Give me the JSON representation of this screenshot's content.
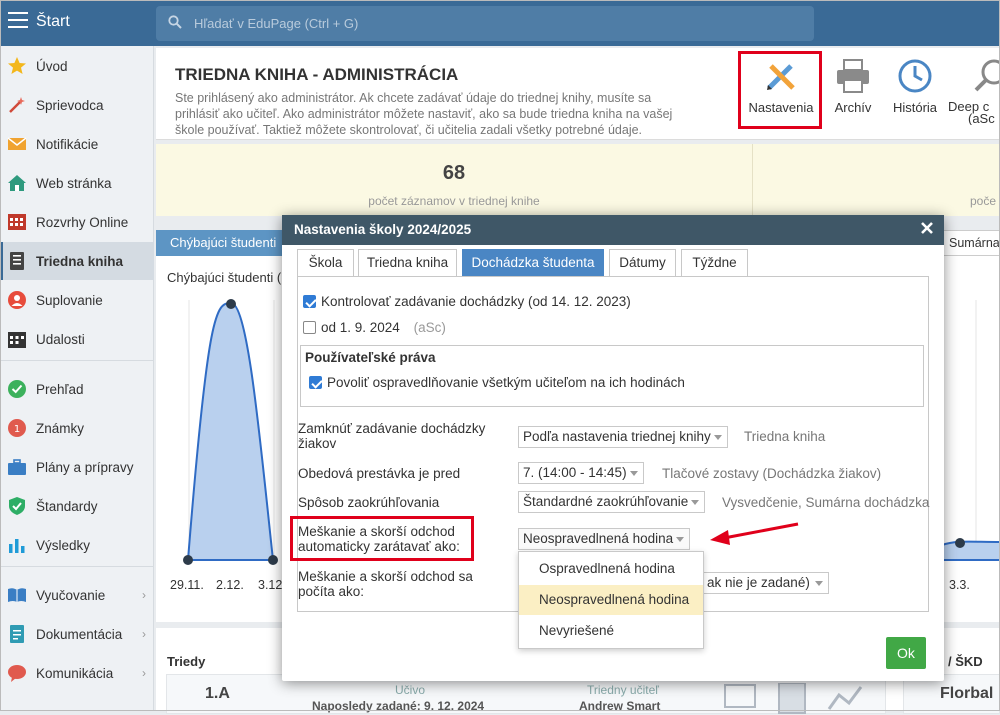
{
  "topbar": {
    "title": "Štart",
    "search_placeholder": "Hľadať v EduPage (Ctrl + G)"
  },
  "sidebar": {
    "items": [
      {
        "label": "Úvod"
      },
      {
        "label": "Sprievodca"
      },
      {
        "label": "Notifikácie"
      },
      {
        "label": "Web stránka"
      },
      {
        "label": "Rozvrhy Online"
      },
      {
        "label": "Triedna kniha"
      },
      {
        "label": "Suplovanie"
      },
      {
        "label": "Udalosti"
      },
      {
        "label": "Prehľad"
      },
      {
        "label": "Známky"
      },
      {
        "label": "Plány a prípravy"
      },
      {
        "label": "Štandardy"
      },
      {
        "label": "Výsledky"
      },
      {
        "label": "Vyučovanie"
      },
      {
        "label": "Dokumentácia"
      },
      {
        "label": "Komunikácia"
      }
    ],
    "active": "Triedna kniha"
  },
  "header": {
    "title": "TRIEDNA KNIHA - ADMINISTRÁCIA",
    "description": "Ste prihlásený ako administrátor. Ak chcete zadávať údaje do triednej knihy, musíte sa prihlásiť ako učiteľ. Ako administrátor môžete nastaviť, ako sa bude triedna kniha na vašej škole používať. Taktiež môžete skontrolovať, či učitelia zadali všetky potrebné údaje.",
    "tools": {
      "settings": "Nastavenia",
      "archive": "Archív",
      "history": "História",
      "deep": "Deep c",
      "deep_sub": "(aSc"
    }
  },
  "stats": {
    "count": "68",
    "count_label": "počet záznamov v triednej knihe",
    "label2": "poče"
  },
  "chart_panel": {
    "tab": "Chýbajúci študenti",
    "tab_right": "Sumárna d",
    "caption": "Chýbajúci študenti (",
    "x_left": [
      "29.11.",
      "2.12.",
      "3.12"
    ],
    "x_right": "3.3."
  },
  "bottom": {
    "classes_title": "Triedy",
    "class_name": "1.A",
    "ucivo_label": "Učivo",
    "last_entered": "Naposledy zadané: 9. 12. 2024",
    "teacher_label": "Triedny učiteľ",
    "teacher": "Andrew Smart",
    "right_title": "/ ŠKD",
    "right_card": "Florbal"
  },
  "modal": {
    "title": "Nastavenia školy 2024/2025",
    "tabs": [
      "Škola",
      "Triedna kniha",
      "Dochádzka študenta",
      "Dátumy",
      "Týždne"
    ],
    "active_tab": "Dochádzka študenta",
    "check_control": {
      "label": "Kontrolovať zadávanie dochádzky (od 14. 12. 2023)",
      "checked": true
    },
    "check_from": {
      "label": "od 1. 9. 2024",
      "extra": "(aSc)",
      "checked": false
    },
    "user_rights": {
      "legend": "Používateľské práva",
      "check_excuse": {
        "label": "Povoliť ospravedlňovanie všetkým učiteľom na ich hodinách",
        "checked": true
      }
    },
    "fields": [
      {
        "label": "Zamknúť zadávanie dochádzky žiakov",
        "value": "Podľa nastavenia triednej knihy",
        "hint": "Triedna kniha"
      },
      {
        "label": "Obedová prestávka je pred",
        "value": "7. (14:00 - 14:45)",
        "hint": "Tlačové zostavy (Dochádzka žiakov)"
      },
      {
        "label": "Spôsob zaokrúhľovania",
        "value": "Štandardné zaokrúhľovanie",
        "hint": "Vysvedčenie, Sumárna dochádzka"
      },
      {
        "label": "Meškanie a skorší odchod automaticky zarátavať ako:",
        "value": "Neospravedlnená hodina",
        "hint": ""
      },
      {
        "label": "Meškanie a skorší odchod sa počíta ako:",
        "value": "ak nie je zadané)",
        "hint": ""
      }
    ],
    "dropdown_options": [
      "Ospravedlnená hodina",
      "Neospravedlnená hodina",
      "Nevyriešené"
    ],
    "dropdown_selected": "Neospravedlnená hodina",
    "ok_label": "Ok"
  },
  "colors": {
    "topbar": "#3a6a96",
    "modal_header": "#3f5767",
    "active_tab": "#4a86c4",
    "highlight": "#e0001b",
    "ok": "#41a846"
  }
}
